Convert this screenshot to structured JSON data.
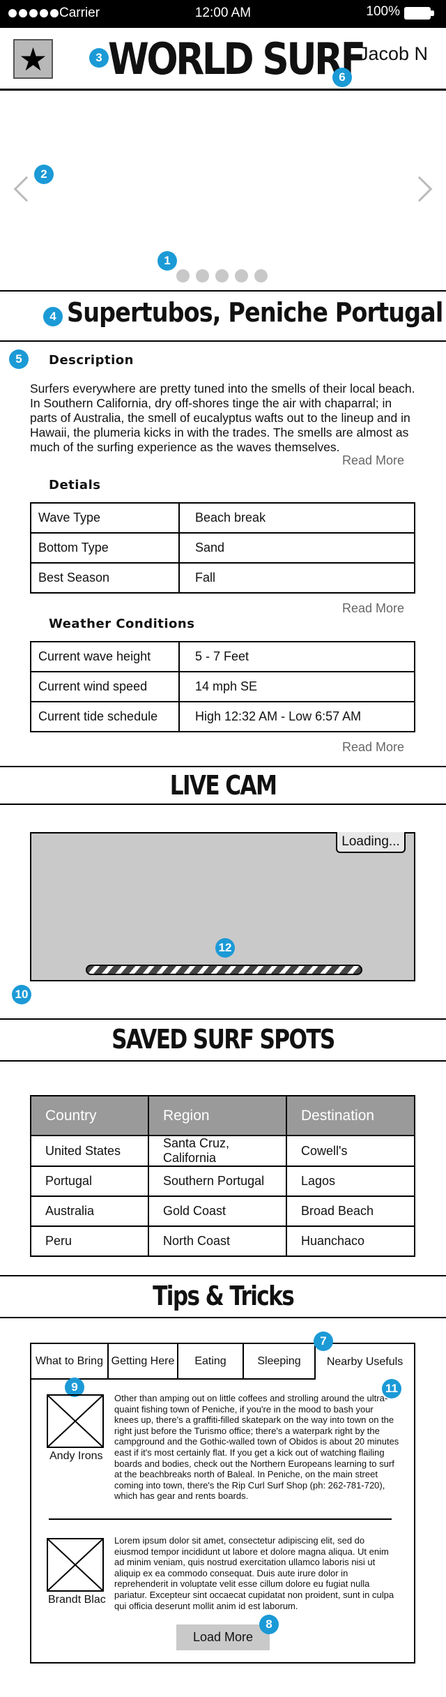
{
  "status_bar": {
    "carrier": "Carrier",
    "time": "12:00 AM",
    "battery": "100%"
  },
  "header": {
    "logo": "WORLD SURF",
    "user": "Jacob N",
    "star_icon": "★"
  },
  "carousel": {
    "dot_count": 5
  },
  "spot": {
    "title": "Supertubos, Peniche Portugal"
  },
  "description": {
    "heading": "Description",
    "text": "Surfers everywhere are pretty tuned into the smells of their local beach. In Southern California, dry off-shores tinge the air with chaparral; in parts of Australia, the smell of eucalyptus wafts out to the lineup and in Hawaii, the plumeria kicks in with the trades. The smells are almost as much of the surfing experience as the waves themselves.",
    "read_more": "Read More"
  },
  "details": {
    "heading": "Detials",
    "rows": [
      [
        "Wave Type",
        "Beach break"
      ],
      [
        "Bottom Type",
        "Sand"
      ],
      [
        "Best Season",
        "Fall"
      ]
    ],
    "read_more": "Read More"
  },
  "weather": {
    "heading": "Weather Conditions",
    "rows": [
      [
        "Current wave height",
        "5 - 7 Feet"
      ],
      [
        "Current wind speed",
        "14 mph SE"
      ],
      [
        "Current tide schedule",
        "High 12:32 AM  -  Low 6:57 AM"
      ]
    ],
    "read_more": "Read More"
  },
  "livecam": {
    "title": "LIVE CAM",
    "loading": "Loading..."
  },
  "saved": {
    "title": "SAVED SURF SPOTS",
    "columns": [
      "Country",
      "Region",
      "Destination"
    ],
    "rows": [
      [
        "United States",
        "Santa Cruz, California",
        "Cowell's"
      ],
      [
        "Portugal",
        "Southern Portugal",
        "Lagos"
      ],
      [
        "Australia",
        "Gold Coast",
        "Broad Beach"
      ],
      [
        "Peru",
        "North Coast",
        "Huanchaco"
      ]
    ]
  },
  "tips": {
    "title": "Tips & Tricks",
    "tabs": [
      "What to Bring",
      "Getting Here",
      "Eating",
      "Sleeping",
      "Nearby Usefuls"
    ],
    "active_tab": "Nearby Usefuls",
    "posts": [
      {
        "author": "Andy Irons",
        "text": "Other than amping out on little coffees and strolling around the ultra-quaint fishing town of Peniche, if you're in the mood to bash your knees up, there's a graffiti-filled skatepark on the way into town on the right just before the Turismo office; there's a waterpark right by the campground and the Gothic-walled town of Obidos is about 20 minutes east if it's most certainly flat. If you get a kick out of watching flailing boards and bodies, check out the Northern Europeans learning to surf at the beachbreaks north of Baleal. In Peniche, on the main street coming into town, there's the Rip Curl Surf Shop (ph: 262-781-720), which has gear and rents boards."
      },
      {
        "author": "Brandt Blac",
        "text": "Lorem ipsum dolor sit amet, consectetur adipiscing elit, sed do eiusmod tempor incididunt ut labore et dolore magna aliqua. Ut enim ad minim veniam, quis nostrud exercitation ullamco laboris nisi ut aliquip ex ea commodo consequat. Duis aute irure dolor in reprehenderit in voluptate velit esse cillum dolore eu fugiat nulla pariatur. Excepteur sint occaecat cupidatat non proident, sunt in culpa qui officia deserunt mollit anim id est laborum."
      }
    ],
    "load_more": "Load More"
  },
  "annotations": [
    "1",
    "2",
    "3",
    "4",
    "5",
    "6",
    "7",
    "8",
    "9",
    "10",
    "11",
    "12"
  ]
}
